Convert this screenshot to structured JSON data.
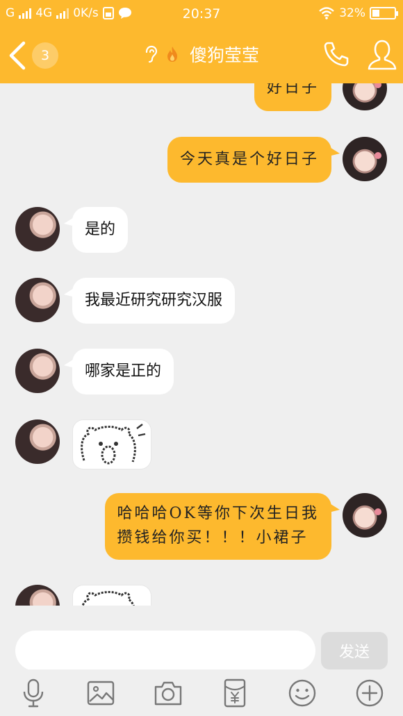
{
  "status_bar": {
    "carrier1": "G",
    "carrier2": "4G",
    "speed": "0K/s",
    "time": "20:37",
    "battery": "32%",
    "battery_level": 0.32
  },
  "header": {
    "unread_count": "3",
    "title": "傻狗莹莹"
  },
  "messages": {
    "m0": "好日子",
    "m1": "今天真是个好日子",
    "m2": "是的",
    "m3": "我最近研究研究汉服",
    "m4": "哪家是正的",
    "m6_line1": "哈哈哈OK等你下次生日我",
    "m6_line2": "攒钱给你买！！！小裙子"
  },
  "composer": {
    "input_value": "",
    "send_label": "发送"
  },
  "toolbar_icons": [
    "microphone-icon",
    "image-icon",
    "camera-icon",
    "red-packet-icon",
    "emoji-icon",
    "plus-icon"
  ],
  "colors": {
    "accent": "#fdb92e",
    "background": "#efefef",
    "incoming_bubble": "#ffffff"
  }
}
